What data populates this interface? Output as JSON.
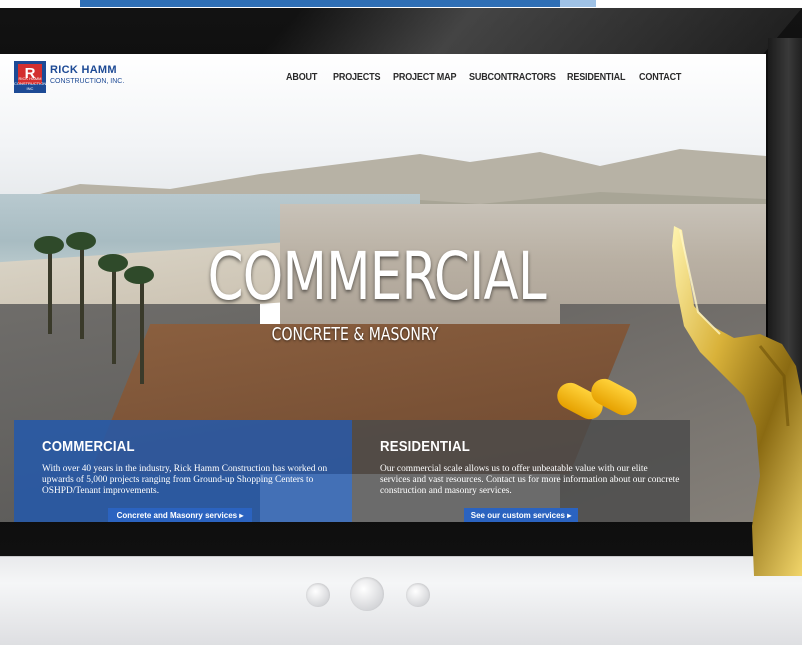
{
  "site": {
    "logo_initial": "R",
    "logo_mini": "RICK HAMM CONSTRUCTION INC",
    "logo_name": "RICK HAMM",
    "logo_sub": "CONSTRUCTION, INC."
  },
  "nav": {
    "items": [
      "ABOUT",
      "PROJECTS",
      "PROJECT MAP",
      "SUBCONTRACTORS",
      "RESIDENTIAL",
      "CONTACT"
    ]
  },
  "hero": {
    "headline": "COMMERCIAL",
    "subheadline": "CONCRETE & MASONRY"
  },
  "panels": {
    "commercial": {
      "title": "COMMERCIAL",
      "text": "With over 40 years in the industry, Rick Hamm Construction has worked on upwards of 5,000 projects ranging from Ground-up Shopping Centers to OSHPD/Tenant improvements.",
      "button": "Concrete and Masonry services  ▸"
    },
    "residential": {
      "title": "RESIDENTIAL",
      "text": "Our commercial scale allows us to offer unbeatable value with our elite services and vast resources. Contact us for more information about our concrete construction and masonry services.",
      "button": "See our custom services  ▸"
    }
  },
  "colors": {
    "brand_blue": "#1d4a95",
    "logo_red": "#d32f2f",
    "panel_blue": "#2458aa",
    "panel_gray": "#4a4a4a",
    "button_blue": "#2b63c0"
  },
  "icons": {
    "trophy": "award-trophy-icon",
    "monitor_dots": "pagination-dot-icon"
  }
}
